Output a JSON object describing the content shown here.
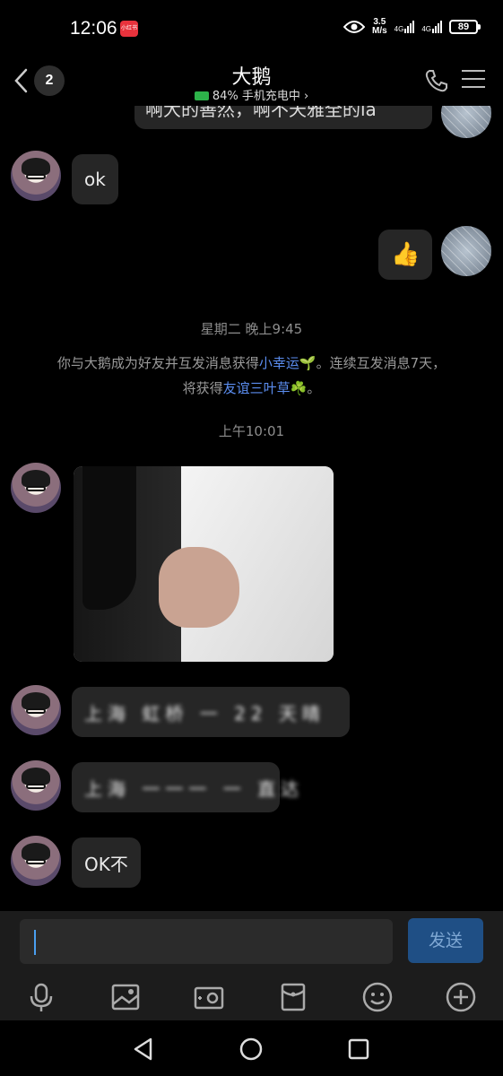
{
  "status_bar": {
    "time": "12:06",
    "app_badge": "小红书",
    "speed_value": "3.5",
    "speed_unit": "M/s",
    "network_1": "4G",
    "network_2": "4G",
    "battery": "89"
  },
  "header": {
    "back_count": "2",
    "title": "大鹅",
    "subtitle": "84% 手机充电中 ›",
    "back_icon": "chevron-left-icon",
    "call_icon": "phone-icon",
    "menu_icon": "menu-icon"
  },
  "messages": {
    "top_partial": "啊大的善然，啊不天雅全的ia",
    "ok": "ok",
    "thumbs": "👍",
    "time_tue": "星期二 晚上9:45",
    "note_line1_prefix": "你与大鹅成为好友并互发消息获得",
    "note_link1": "小幸运🌱",
    "note_line1_suffix": "。连续互发消息7天，",
    "note_line2_prefix": "将获得",
    "note_link2": "友谊三叶草☘️",
    "note_line2_suffix": "。",
    "time_am": "上午10:01",
    "blur1": "上海 虹桥  一 22 天晴",
    "blur2": "上海 一一一 一 直达",
    "ok_no": "OK不"
  },
  "input": {
    "send_label": "发送"
  },
  "toolbar": {
    "icons": [
      "microphone-icon",
      "image-icon",
      "camera-icon",
      "red-packet-icon",
      "emoji-icon",
      "plus-icon"
    ]
  },
  "nav": {
    "icons": [
      "back-triangle-icon",
      "home-circle-icon",
      "recents-square-icon"
    ]
  },
  "colors": {
    "background": "#000000",
    "bubble": "#262626",
    "link": "#5b8def",
    "send_button": "#1f4f85"
  }
}
